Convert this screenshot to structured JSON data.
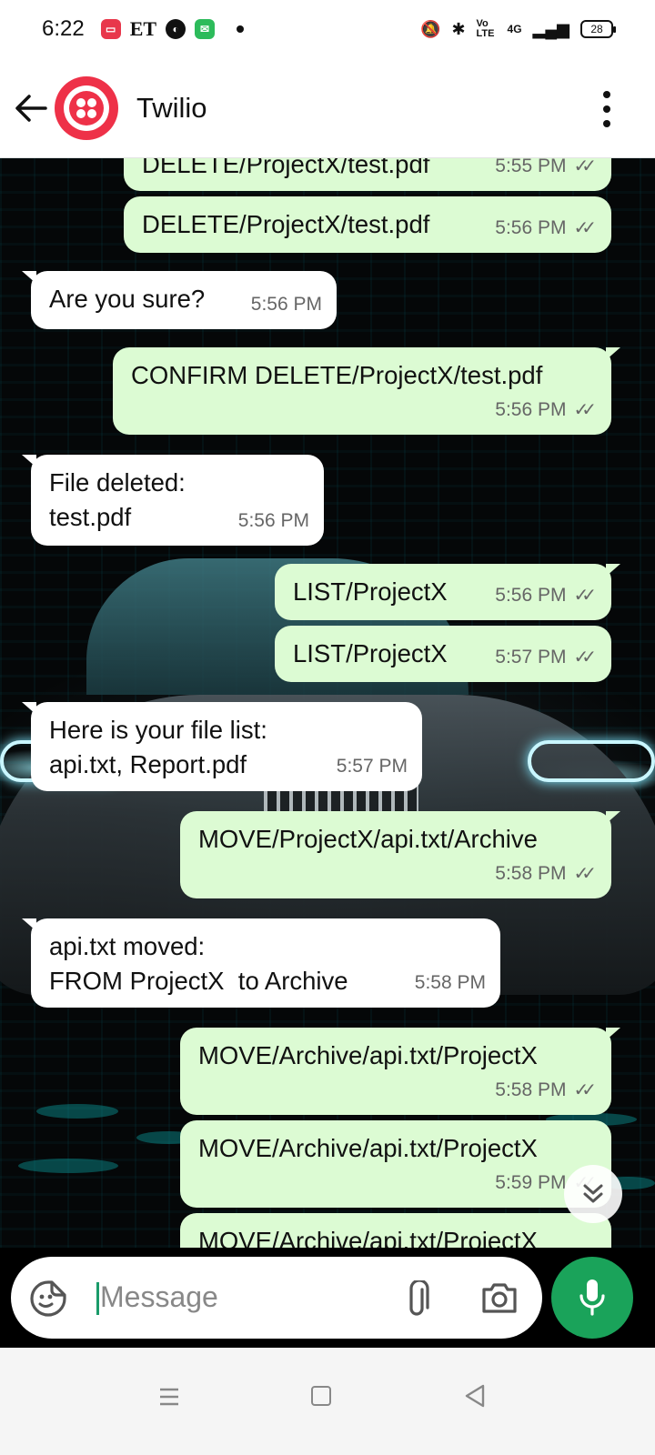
{
  "status_bar": {
    "time": "6:22",
    "app_icons": [
      "recorder-icon",
      "ET",
      "browser-icon",
      "messages-icon"
    ],
    "network": "4G",
    "volte": "Vo LTE",
    "battery": "28"
  },
  "header": {
    "contact_name": "Twilio",
    "avatar_color": "#ee3148"
  },
  "messages": [
    {
      "dir": "out",
      "text": "DELETE/ProjectX/test.pdf",
      "time": "5:55 PM",
      "ticks": "✓✓"
    },
    {
      "dir": "out",
      "text": "DELETE/ProjectX/test.pdf",
      "time": "5:56 PM",
      "ticks": "✓✓"
    },
    {
      "dir": "in",
      "text": "Are you sure?",
      "time": "5:56 PM"
    },
    {
      "dir": "out",
      "text": "CONFIRM DELETE/ProjectX/test.pdf",
      "time": "5:56 PM",
      "ticks": "✓✓"
    },
    {
      "dir": "in",
      "text": "File deleted:\ntest.pdf",
      "time": "5:56 PM"
    },
    {
      "dir": "out",
      "text": "LIST/ProjectX",
      "time": "5:56 PM",
      "ticks": "✓✓"
    },
    {
      "dir": "out",
      "text": "LIST/ProjectX",
      "time": "5:57 PM",
      "ticks": "✓✓"
    },
    {
      "dir": "in",
      "text": "Here is your file list:\napi.txt, Report.pdf",
      "time": "5:57 PM"
    },
    {
      "dir": "out",
      "text": "MOVE/ProjectX/api.txt/Archive",
      "time": "5:58 PM",
      "ticks": "✓✓"
    },
    {
      "dir": "in",
      "text": "api.txt moved:\nFROM ProjectX  to Archive",
      "time": "5:58 PM"
    },
    {
      "dir": "out",
      "text": "MOVE/Archive/api.txt/ProjectX",
      "time": "5:58 PM",
      "ticks": "✓✓"
    },
    {
      "dir": "out",
      "text": "MOVE/Archive/api.txt/ProjectX",
      "time": "5:59 PM",
      "ticks": "✓✓"
    },
    {
      "dir": "out",
      "text": "MOVE/Archive/api.txt/ProjectX",
      "time": "",
      "ticks": ""
    }
  ],
  "composer": {
    "placeholder": "Message"
  },
  "colors": {
    "outgoing_bubble": "#dcfbd3",
    "incoming_bubble": "#ffffff",
    "accent": "#1aa35a"
  }
}
